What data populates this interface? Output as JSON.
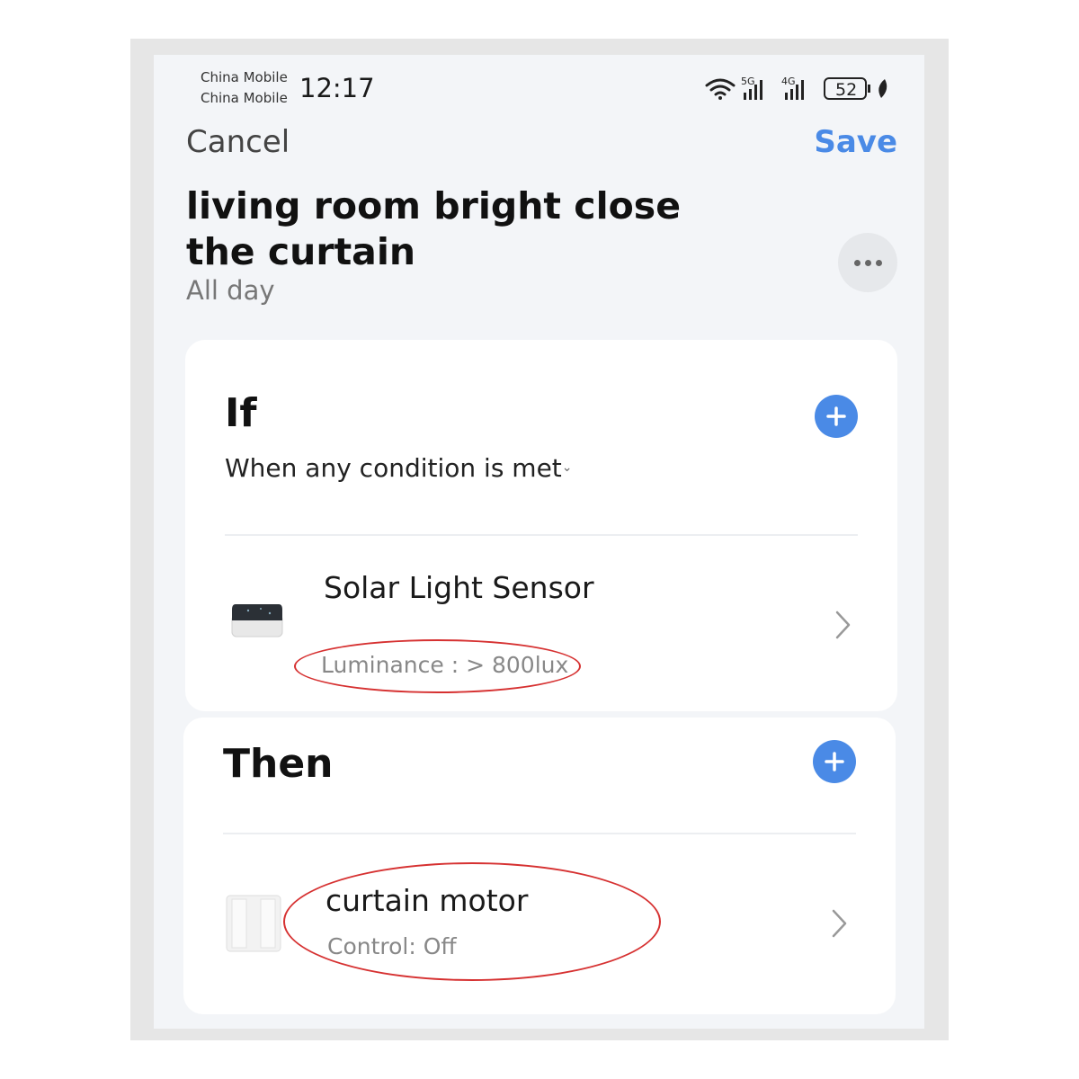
{
  "status_bar": {
    "carrier_1": "China Mobile",
    "carrier_2": "China Mobile",
    "time": "12:17",
    "network_5g": "5G",
    "network_4g": "4G",
    "battery": "52"
  },
  "nav": {
    "cancel_label": "Cancel",
    "save_label": "Save"
  },
  "scene": {
    "title": "living room bright close the curtain",
    "schedule": "All day"
  },
  "if_section": {
    "heading": "If",
    "condition_mode": "When any condition is met",
    "conditions": [
      {
        "device_name": "Solar Light Sensor",
        "detail": "Luminance : > 800lux"
      }
    ]
  },
  "then_section": {
    "heading": "Then",
    "actions": [
      {
        "device_name": "curtain motor",
        "detail": "Control: Off"
      }
    ]
  },
  "colors": {
    "accent": "#4a8ae6",
    "annotation": "#d63131",
    "background": "#f3f5f8"
  }
}
